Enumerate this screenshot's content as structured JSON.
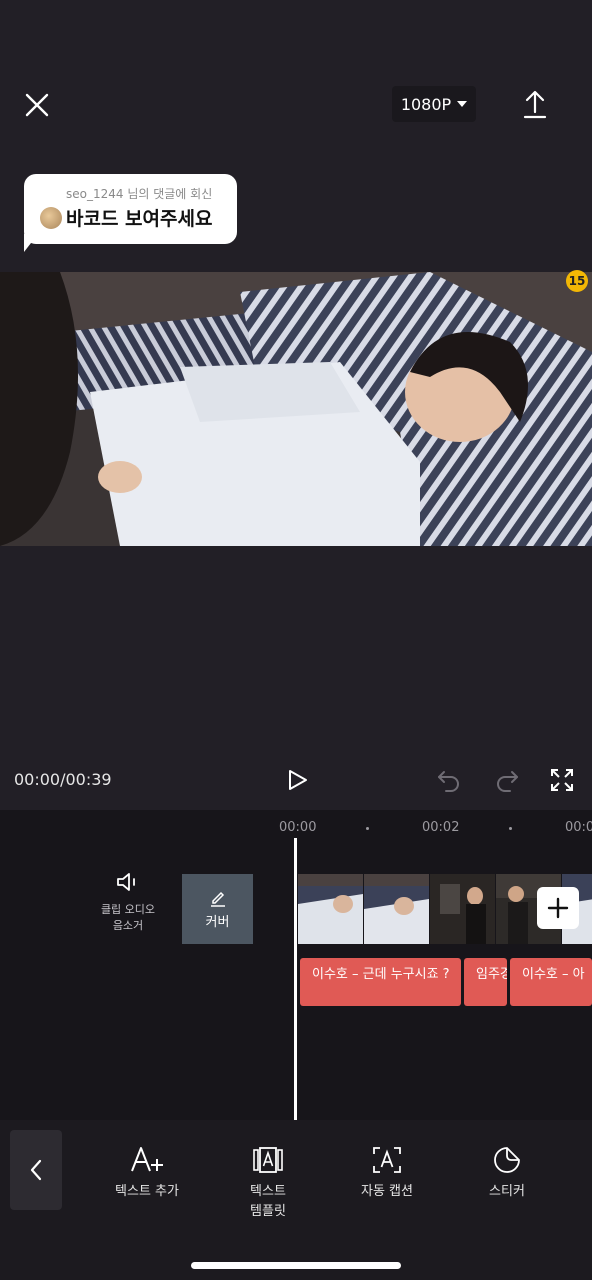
{
  "header": {
    "resolution": "1080P"
  },
  "reply_comment": {
    "user_line": "seo_1244 님의 댓글에 회신",
    "text": "바코드 보여주세요"
  },
  "video": {
    "age_badge": "15"
  },
  "playback": {
    "time": "00:00/00:39"
  },
  "timeline": {
    "ticks": [
      "00:00",
      "00:02",
      "00:0"
    ],
    "mute_label_line1": "클립 오디오",
    "mute_label_line2": "음소거",
    "cover_label": "커버",
    "captions": [
      "이수호 – 근데 누구시죠 ?",
      "임주경",
      "이수호 – 아"
    ]
  },
  "toolbar": {
    "tools": [
      {
        "label": "텍스트 추가",
        "icon": "text-add-icon"
      },
      {
        "label_line1": "텍스트",
        "label_line2": "템플릿",
        "icon": "text-template-icon"
      },
      {
        "label": "자동 캡션",
        "icon": "auto-caption-icon"
      },
      {
        "label": "스티커",
        "icon": "sticker-icon"
      }
    ]
  },
  "colors": {
    "background": "#221f26",
    "caption": "#e05a55",
    "timeline_bg": "#17151a"
  }
}
